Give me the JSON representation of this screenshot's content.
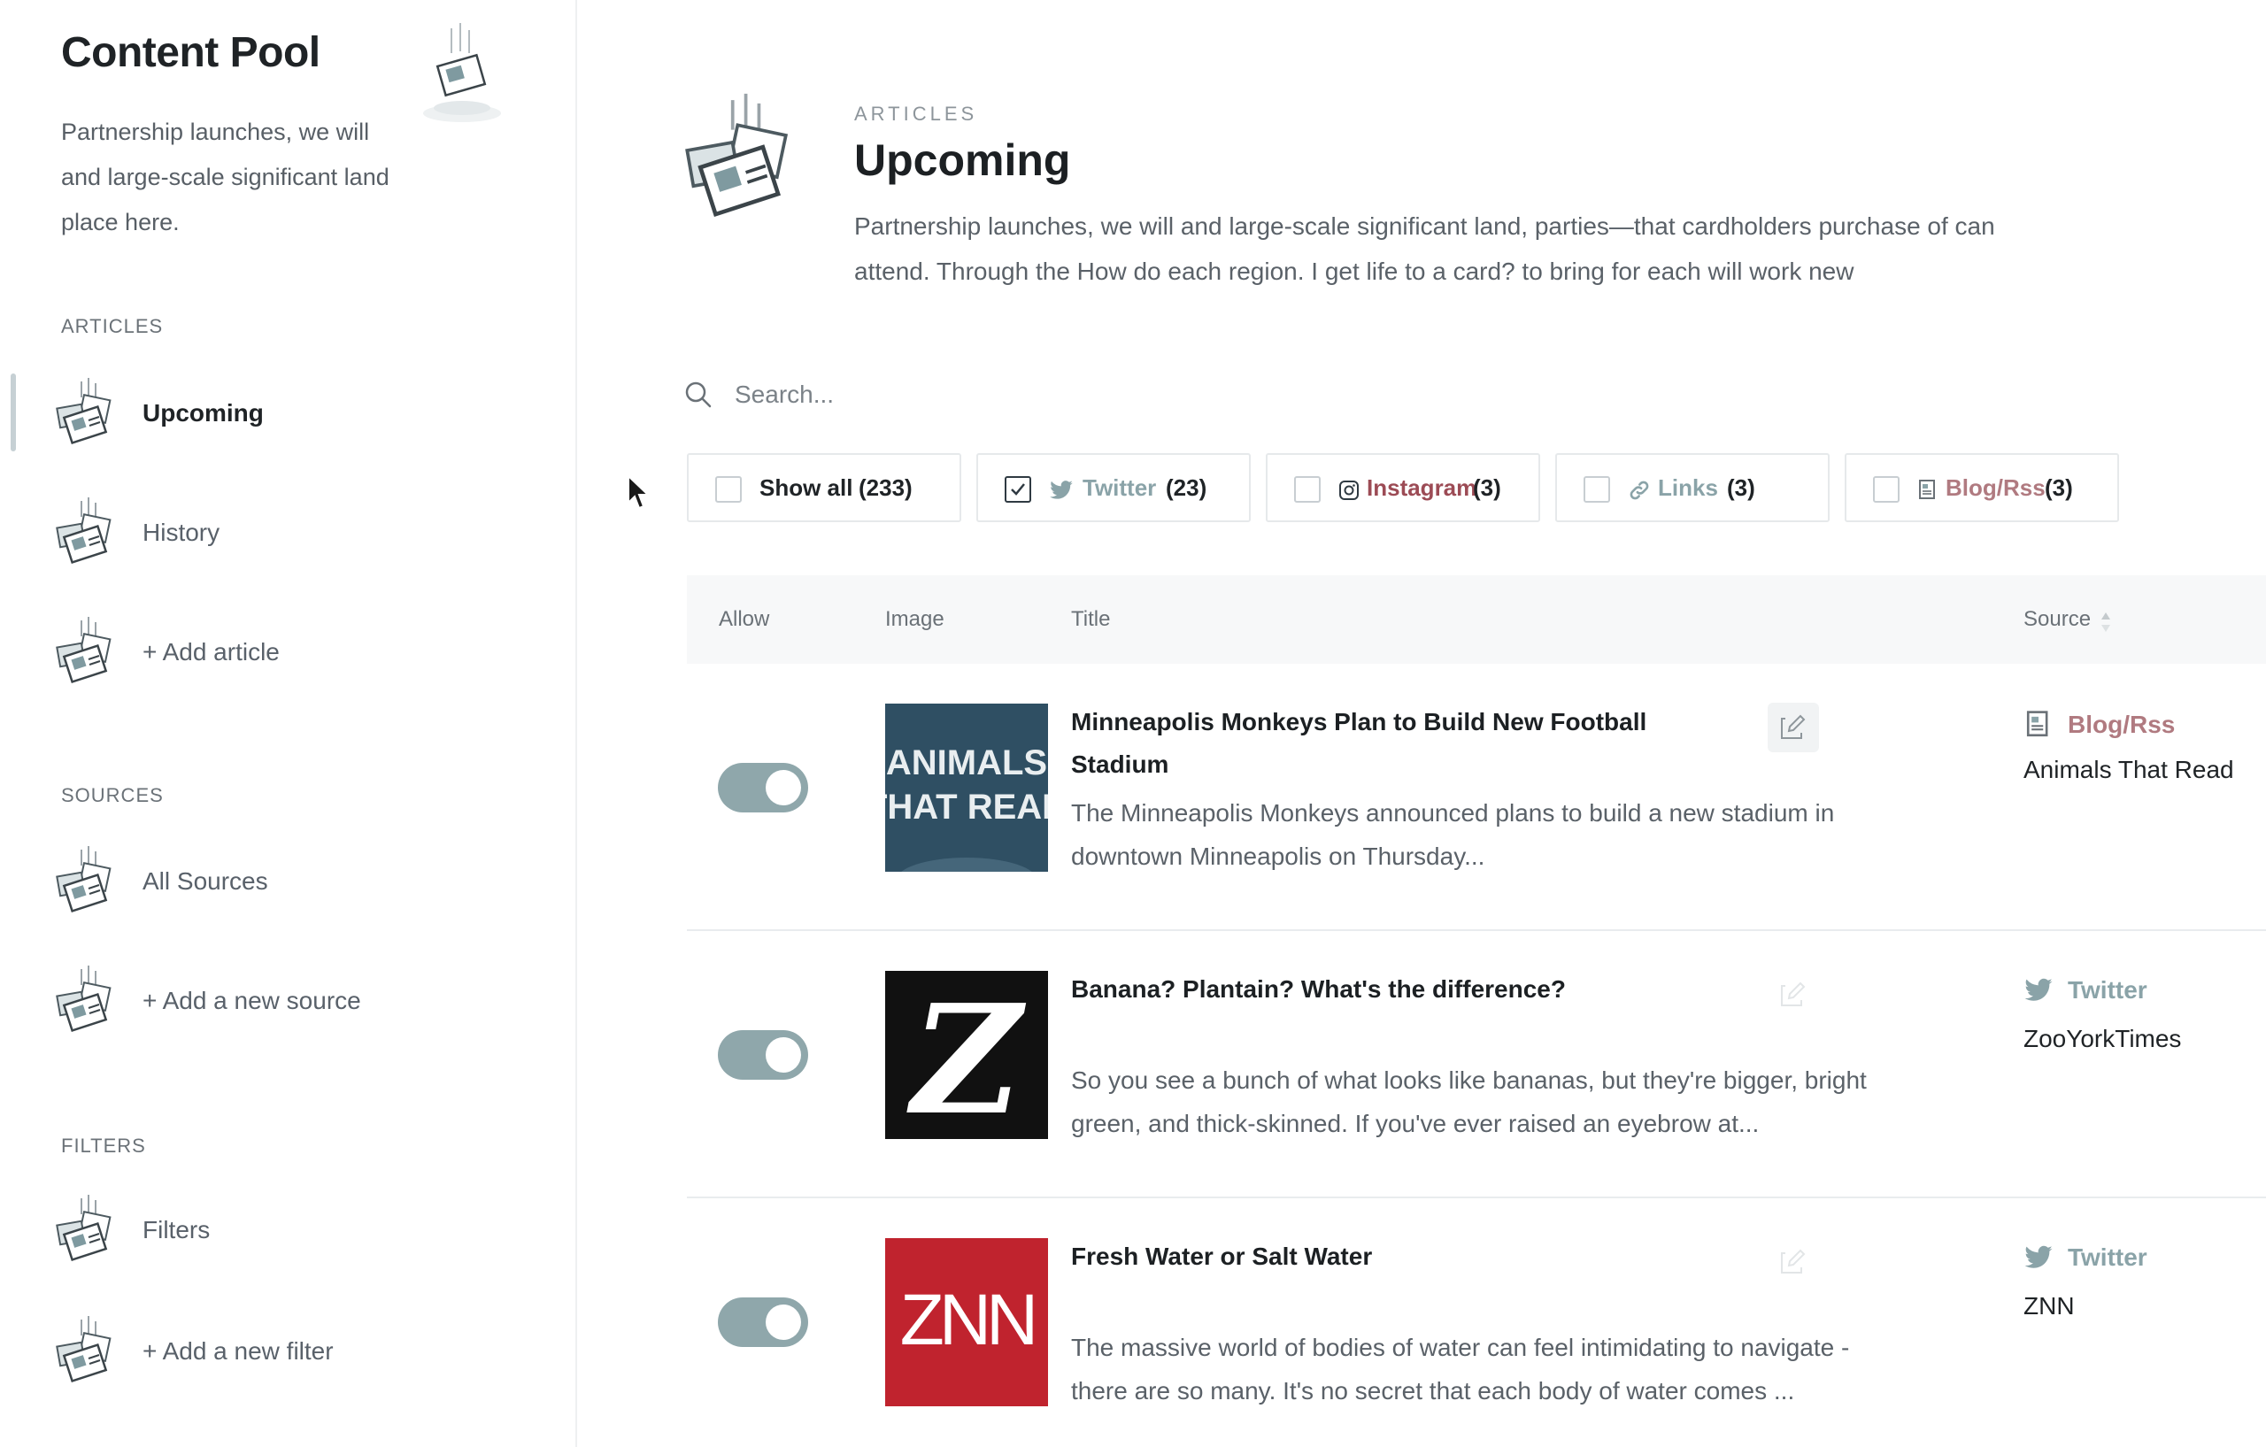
{
  "sidebar": {
    "title": "Content Pool",
    "description": "Partnership launches, we will and large-scale significant land place here.",
    "sections": {
      "articles": "ARTICLES",
      "sources": "SOURCES",
      "filters": "FILTERS"
    },
    "items": [
      {
        "label": "Upcoming",
        "active": true
      },
      {
        "label": "History"
      },
      {
        "label": "+ Add article"
      },
      {
        "label": "All Sources"
      },
      {
        "label": "+ Add a new source"
      },
      {
        "label": "Filters"
      },
      {
        "label": "+ Add a new filter"
      }
    ]
  },
  "header": {
    "kicker": "ARTICLES",
    "title": "Upcoming",
    "description": "Partnership launches, we will and large-scale significant land, parties—that cardholders purchase of can attend. Through the How do each region. I get life to a card? to bring for each will work new"
  },
  "search": {
    "placeholder": "Search...",
    "icon": "search-icon"
  },
  "filters": [
    {
      "label": "Show all",
      "count": "(233)",
      "checked": false,
      "icon": null,
      "color": "#1f2326"
    },
    {
      "label": "Twitter",
      "count": "(23)",
      "checked": true,
      "icon": "twitter-icon",
      "color": "#8aa3a8"
    },
    {
      "label": "Instagram",
      "count": "(3)",
      "checked": false,
      "icon": "instagram-icon",
      "color": "#9c4b55"
    },
    {
      "label": "Links",
      "count": "(3)",
      "checked": false,
      "icon": "link-icon",
      "color": "#8aa3a8"
    },
    {
      "label": "Blog/Rss",
      "count": "(3)",
      "checked": false,
      "icon": "blog-rss-icon",
      "color": "#b07a80"
    }
  ],
  "table": {
    "headers": {
      "allow": "Allow",
      "image": "Image",
      "title": "Title",
      "source": "Source"
    },
    "rows": [
      {
        "allowed": true,
        "thumb": {
          "lines": [
            "ANIMALS",
            "THAT READ"
          ],
          "bg": "#2f4f63"
        },
        "title": "Minneapolis Monkeys Plan to Build New Football Stadium",
        "description": "The Minneapolis Monkeys announced plans to build a new stadium in downtown Minneapolis on Thursday...",
        "source_type": "Blog/Rss",
        "source_name": "Animals That Read"
      },
      {
        "allowed": true,
        "thumb": {
          "lines": [
            "Z"
          ],
          "bg": "#111111"
        },
        "title": "Banana? Plantain? What's the difference?",
        "description": "So you see a bunch of what looks like bananas, but they're bigger, bright green, and thick-skinned. If you've ever raised an eyebrow at...",
        "source_type": "Twitter",
        "source_name": "ZooYorkTimes"
      },
      {
        "allowed": true,
        "thumb": {
          "lines": [
            "ZNN"
          ],
          "bg": "#c0232e"
        },
        "title": "Fresh Water or Salt Water",
        "description": "The massive world of bodies of water can feel intimidating to navigate - there are so many. It's no secret that each body of water comes ...",
        "source_type": "Twitter",
        "source_name": "ZNN"
      }
    ]
  },
  "colors": {
    "accent": "#8fa7ab",
    "twitter": "#8aa3a8",
    "instagram": "#9c4b55",
    "blog_rss": "#b07a80"
  }
}
